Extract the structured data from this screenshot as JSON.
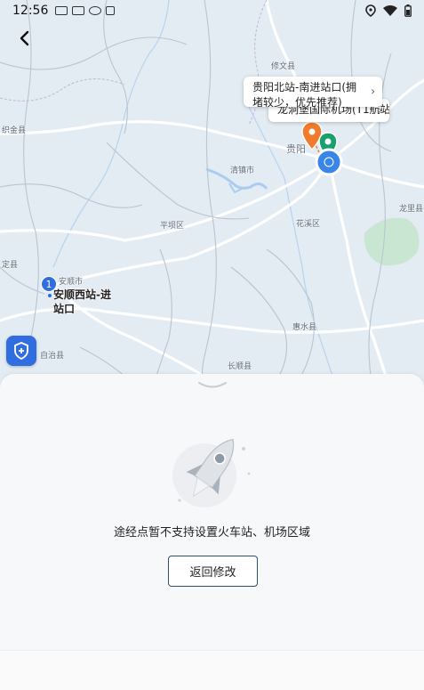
{
  "status_bar": {
    "time": "12:56"
  },
  "map": {
    "place_labels": [
      {
        "id": "xiuwen",
        "text": "修文县"
      },
      {
        "id": "zhijin",
        "text": "织金县"
      },
      {
        "id": "guiyang",
        "text": "贵阳"
      },
      {
        "id": "qingzhen",
        "text": "清镇市"
      },
      {
        "id": "pingba",
        "text": "平坝区"
      },
      {
        "id": "huaxi",
        "text": "花溪区"
      },
      {
        "id": "longli",
        "text": "龙里县"
      },
      {
        "id": "ding",
        "text": "定县"
      },
      {
        "id": "anshun",
        "text": "安顺市"
      },
      {
        "id": "zizhi",
        "text": "自治县"
      },
      {
        "id": "huishui",
        "text": "惠水县"
      },
      {
        "id": "changshun",
        "text": "长顺县"
      }
    ],
    "callout_back": {
      "text": "龙洞堡国际机场(T1航站)"
    },
    "callout_front": {
      "text": "贵阳北站-南进站口(拥堵较少，优先推荐)"
    },
    "via_point": {
      "number": "1",
      "text": "安顺西站-进站口"
    },
    "marker_colors": {
      "start": "#19a06c",
      "end": "#f07b2a",
      "current": "#3a86e8",
      "via": "#2f6de1"
    }
  },
  "sheet": {
    "message": "途经点暂不支持设置火车站、机场区域",
    "button_label": "返回修改"
  }
}
